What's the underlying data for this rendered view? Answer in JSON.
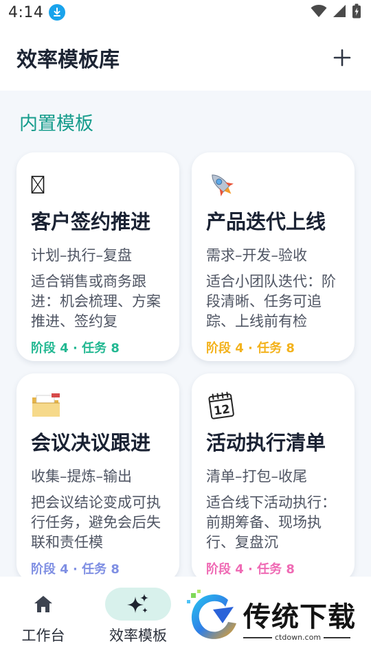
{
  "status_bar": {
    "time": "4:14"
  },
  "header": {
    "title": "效率模板库"
  },
  "section": {
    "title": "内置模板"
  },
  "templates": [
    {
      "icon": "🤝",
      "title": "客户签约推进",
      "flow": "计划–执行–复盘",
      "desc": "适合销售或商务跟进：机会梳理、方案推进、签约复",
      "meta": "阶段 4 · 任务 8",
      "accent": "#23b892"
    },
    {
      "icon": "🚀",
      "title": "产品迭代上线",
      "flow": "需求–开发–验收",
      "desc": "适合小团队迭代：阶段清晰、任务可追踪、上线前有检",
      "meta": "阶段 4 · 任务 8",
      "accent": "#f3b21c"
    },
    {
      "icon": "📁",
      "title": "会议决议跟进",
      "flow": "收集–提炼–输出",
      "desc": "把会议结论变成可执行任务，避免会后失联和责任模",
      "meta": "阶段 4 · 任务 8",
      "accent": "#7f8fe3"
    },
    {
      "icon": "📆",
      "title": "活动执行清单",
      "flow": "清单–打包–收尾",
      "desc": "适合线下活动执行：前期筹备、现场执行、复盘沉",
      "meta": "阶段 4 · 任务 8",
      "accent": "#ef6ab4"
    }
  ],
  "bottom_nav": {
    "items": [
      {
        "label": "工作台",
        "icon": "home-icon",
        "active": false
      },
      {
        "label": "效率模板",
        "icon": "sparkles-icon",
        "active": true
      }
    ]
  },
  "watermark": {
    "name": "传统下载",
    "url": "ctdown.com"
  }
}
